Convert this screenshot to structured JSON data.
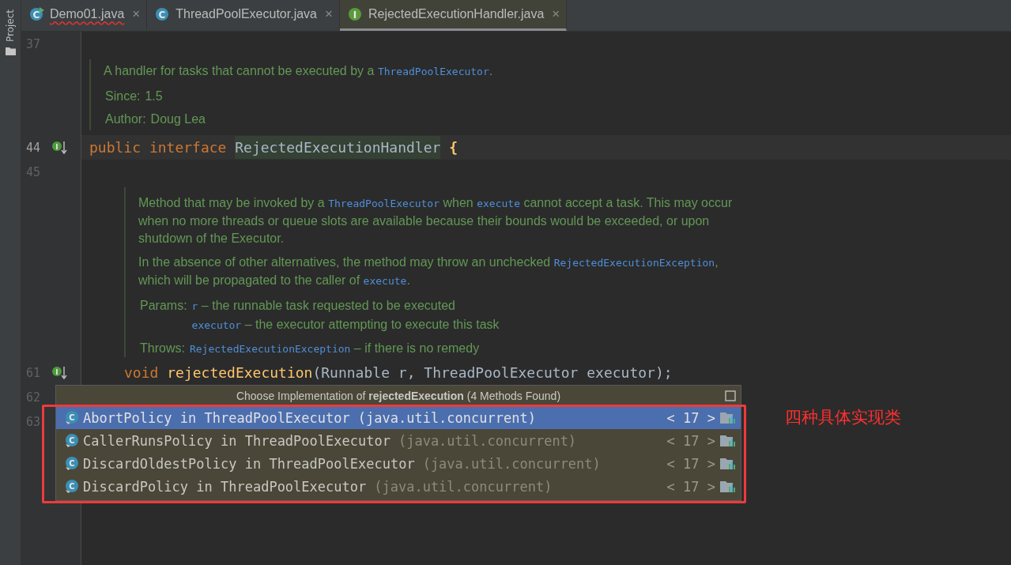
{
  "tool_window": {
    "label": "Project"
  },
  "tabs": [
    {
      "label": "Demo01.java",
      "kind": "runnable-class",
      "icon_letter": "C",
      "error": true,
      "selected": false,
      "close": "×"
    },
    {
      "label": "ThreadPoolExecutor.java",
      "kind": "class",
      "icon_letter": "C",
      "error": false,
      "selected": false,
      "close": "×"
    },
    {
      "label": "RejectedExecutionHandler.java",
      "kind": "interface",
      "icon_letter": "I",
      "error": false,
      "selected": true,
      "close": "×"
    }
  ],
  "lines": [
    {
      "kind": "code",
      "number": "37",
      "current": false
    },
    {
      "kind": "doc",
      "paragraphs": [
        [
          {
            "text": "A handler for tasks that cannot be executed by a ",
            "kind": "text"
          },
          {
            "text": "ThreadPoolExecutor",
            "kind": "code"
          },
          {
            "text": ".",
            "kind": "text"
          }
        ]
      ],
      "fields": [
        {
          "label": "Since:",
          "entries": [
            [
              {
                "text": "1.5",
                "kind": "text"
              }
            ]
          ]
        },
        {
          "label": "Author:",
          "entries": [
            [
              {
                "text": "Doug Lea",
                "kind": "text"
              }
            ]
          ]
        }
      ]
    },
    {
      "kind": "code",
      "number": "44",
      "current": true,
      "marker_letter": "I",
      "tokens": [
        {
          "text": "public",
          "kind": "keyword"
        },
        {
          "text": "interface",
          "kind": "keyword"
        },
        {
          "text": "RejectedExecutionHandler",
          "kind": "highlighted"
        },
        {
          "text": "{",
          "kind": "brace"
        }
      ],
      "children": [
        {
          "kind": "code",
          "number": "45",
          "current": false
        },
        {
          "kind": "doc",
          "paragraphs": [
            [
              {
                "text": "Method that may be invoked by a ",
                "kind": "text"
              },
              {
                "text": "ThreadPoolExecutor",
                "kind": "code"
              },
              {
                "text": " when ",
                "kind": "text"
              },
              {
                "text": "execute",
                "kind": "code"
              },
              {
                "text": " cannot accept a task. This may occur when no more threads or queue slots are available because their bounds would be exceeded, or upon shutdown of the Executor.",
                "kind": "text"
              }
            ],
            [
              {
                "text": "In the absence of other alternatives, the method may throw an unchecked ",
                "kind": "text"
              },
              {
                "text": "RejectedExecutionException",
                "kind": "code"
              },
              {
                "text": ", which will be propagated to the caller of ",
                "kind": "text"
              },
              {
                "text": "execute",
                "kind": "code"
              },
              {
                "text": ".",
                "kind": "text"
              }
            ]
          ],
          "fields": [
            {
              "label": "Params:",
              "entries": [
                [
                  {
                    "text": "r",
                    "kind": "code"
                  },
                  {
                    "text": " – the runnable task requested to be executed",
                    "kind": "text"
                  }
                ],
                [
                  {
                    "text": "executor",
                    "kind": "code"
                  },
                  {
                    "text": " – the executor attempting to execute this task",
                    "kind": "text"
                  }
                ]
              ]
            },
            {
              "label": "Throws:",
              "entries": [
                [
                  {
                    "text": "RejectedExecutionException",
                    "kind": "code"
                  },
                  {
                    "text": " – if there is no remedy",
                    "kind": "text"
                  }
                ]
              ]
            }
          ]
        },
        {
          "kind": "code",
          "number": "61",
          "current": false,
          "marker_letter": "I",
          "tokens": [
            {
              "text": "void",
              "kind": "keyword"
            },
            {
              "text": "rejectedExecution",
              "kind": "method"
            },
            {
              "text": "(Runnable r, ThreadPoolExecutor executor);",
              "kind": "plain",
              "glue": true
            }
          ]
        },
        {
          "kind": "code",
          "number": "62",
          "current": false
        },
        {
          "kind": "code",
          "number": "63",
          "current": false
        }
      ]
    }
  ],
  "popup": {
    "title": "Choose Implementation of **rejectedExecution** (4 Methods Found)",
    "items": [
      {
        "name": "AbortPolicy in ThreadPoolExecutor",
        "package": "(java.util.concurrent)",
        "icon_letter": "C",
        "usages": "< 17 >",
        "selected": true
      },
      {
        "name": "CallerRunsPolicy in ThreadPoolExecutor",
        "package": "(java.util.concurrent)",
        "icon_letter": "C",
        "usages": "< 17 >",
        "selected": false
      },
      {
        "name": "DiscardOldestPolicy in ThreadPoolExecutor",
        "package": "(java.util.concurrent)",
        "icon_letter": "C",
        "usages": "< 17 >",
        "selected": false
      },
      {
        "name": "DiscardPolicy in ThreadPoolExecutor",
        "package": "(java.util.concurrent)",
        "icon_letter": "C",
        "usages": "< 17 >",
        "selected": false
      }
    ]
  },
  "annotation": {
    "text": "四种具体实现类",
    "color": "#ff3030"
  }
}
